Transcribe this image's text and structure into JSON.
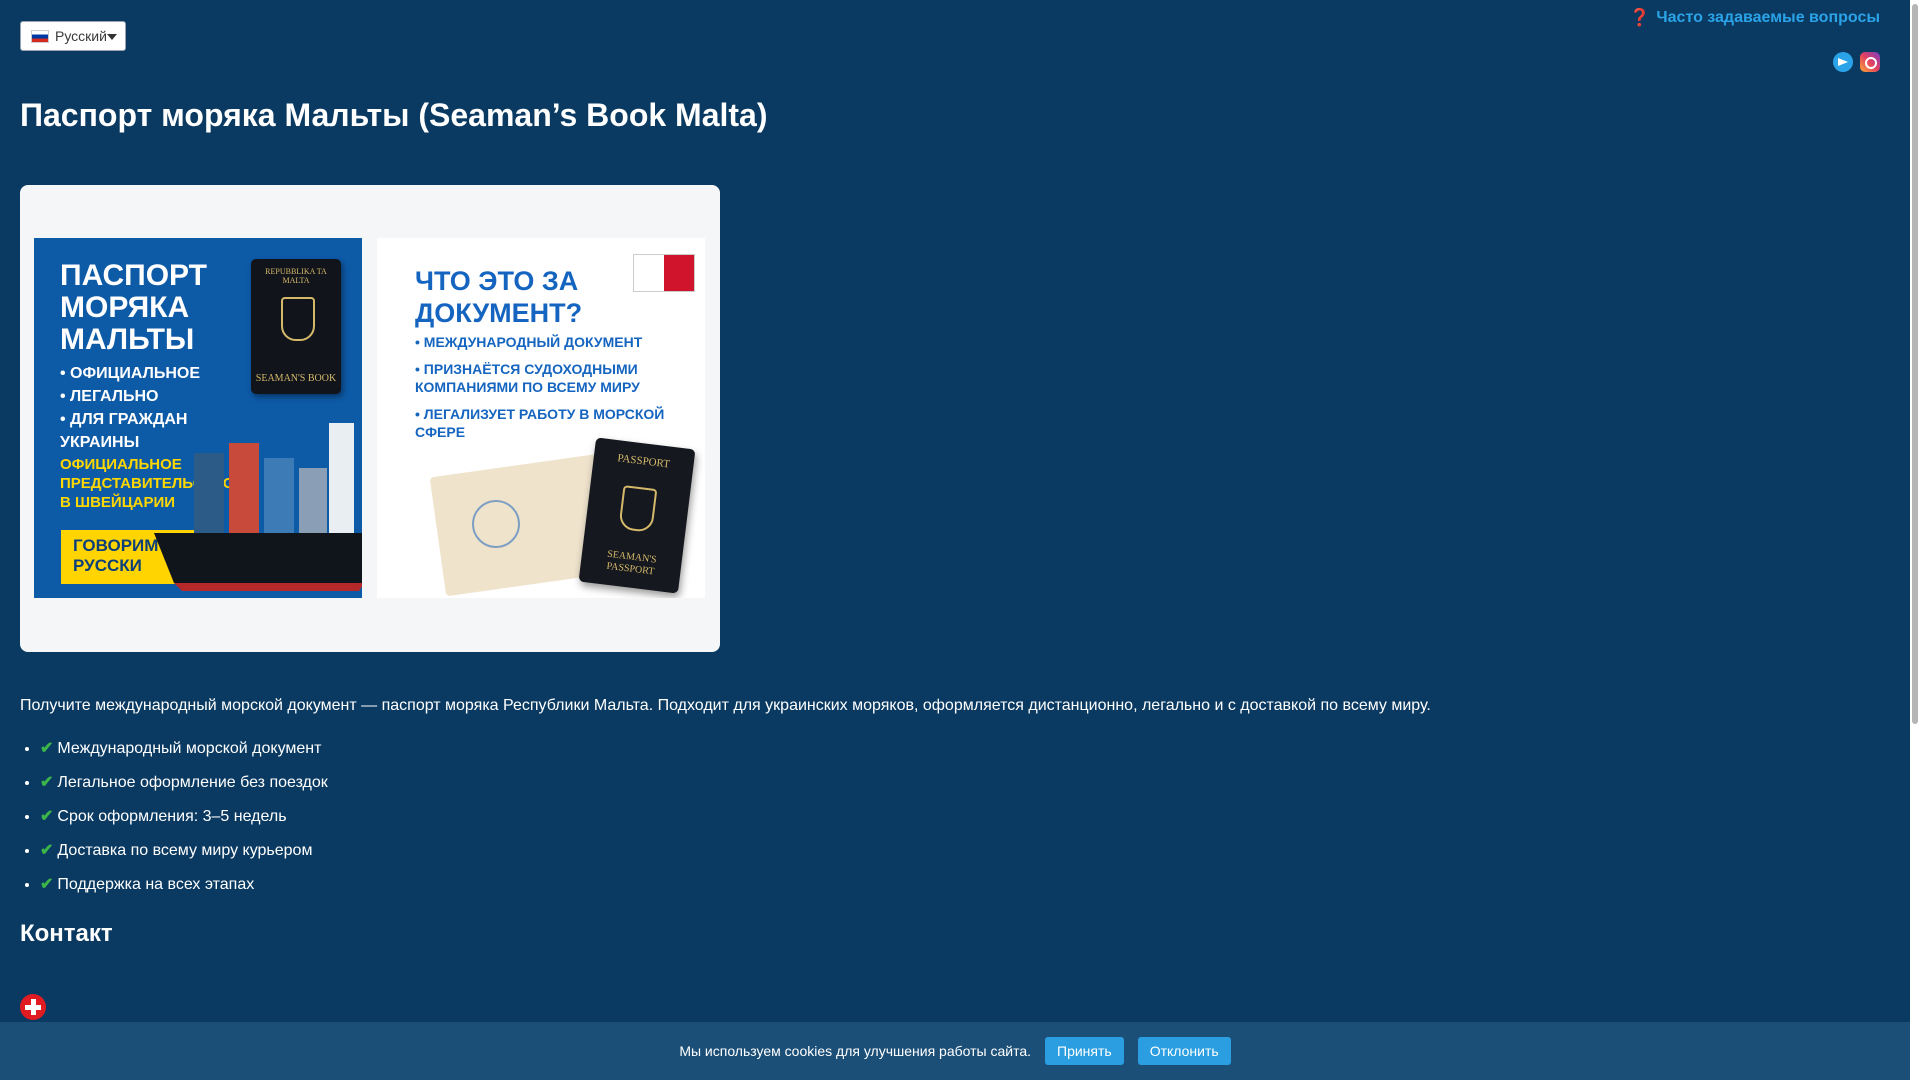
{
  "language_selector": {
    "selected": "Русский"
  },
  "header": {
    "faq_link": "Часто задаваемые вопросы",
    "faq_icon": "❓",
    "social": [
      "telegram-icon",
      "instagram-icon"
    ]
  },
  "page": {
    "title": "Паспорт моряка Мальты (Seaman’s Book Malta)",
    "intro": "Получите международный морской документ — паспорт моряка Республики Мальта. Подходит для украинских моряков, оформляется дистанционно, легально и с доставкой по всему миру.",
    "features": [
      "Международный морской документ",
      "Легальное оформление без поездок",
      "Срок оформления: 3–5 недель",
      "Доставка по всему миру курьером",
      "Поддержка на всех этапах"
    ],
    "contact_heading": "Контакт"
  },
  "banner": {
    "left": {
      "title": "ПАСПОРТ МОРЯКА МАЛЬТЫ",
      "bullets": [
        "• ОФИЦИАЛЬНОЕ",
        "• ЛЕГАЛЬНО",
        "• ДЛЯ ГРАЖДАН УКРАИНЫ"
      ],
      "office": "ОФИЦИАЛЬНОЕ ПРЕДСТАВИТЕЛЬСТВО В ШВЕЙЦАРИИ",
      "button": "ГОВОРИМ ПО-РУССКИ",
      "passport_top": "REPUBBLIKA TA MALTA",
      "passport_bottom": "SEAMAN'S BOOK"
    },
    "right": {
      "title": "ЧТО ЭТО ЗА ДОКУМЕНТ?",
      "bullets": [
        "• МЕЖДУНАРОДНЫЙ ДОКУМЕНТ",
        "• ПРИЗНАЁТСЯ СУДОХОДНЫМИ КОМПАНИЯМИ ПО ВСЕМУ МИРУ",
        "• ЛЕГАЛИЗУЕТ РАБОТУ В МОРСКОЙ СФЕРЕ"
      ],
      "passport_top": "PASSPORT",
      "passport_bottom": "SEAMAN'S PASSPORT"
    }
  },
  "cookie_bar": {
    "text": "Мы используем cookies для улучшения работы сайта.",
    "accept": "Принять",
    "decline": "Отклонить"
  },
  "colors": {
    "background": "#0a3a61",
    "accent": "#2aa3e8",
    "cookie_bar": "#1c4f77"
  }
}
